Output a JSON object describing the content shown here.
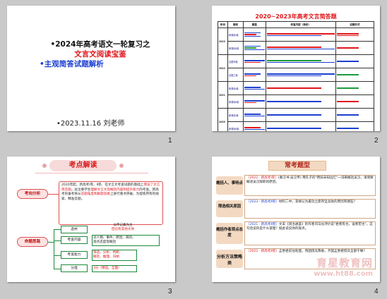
{
  "slides": [
    {
      "number": "1",
      "title_line1": "•2024年高考语文一轮复习之",
      "title_line2": "文言文阅读宝鉴",
      "title_line3": "•主观简答试题解析",
      "date_author": "•2023.11.16  刘老师"
    },
    {
      "number": "2",
      "title": "2020~2023年高考文言简答题",
      "table_headers": [
        "年份",
        "卷别",
        "题型",
        "考查内容（简析）",
        "设题形式"
      ],
      "years": [
        "2023",
        "2022",
        "2021",
        "2020"
      ],
      "papers": [
        "新课标Ⅰ卷",
        "新课标Ⅱ卷",
        "全国甲卷",
        "全国乙卷"
      ]
    },
    {
      "number": "3",
      "title": "考点解读",
      "label_analysis": "考向分析",
      "analysis_text_a": "2020年起，新高考Ⅰ卷、Ⅱ卷、在文言文考查试题的基础上",
      "analysis_text_hl1": "增设了文言简答题",
      "analysis_text_b": "。此注重学生",
      "analysis_text_hl2": "理解文言文及概括内容和提升能力",
      "analysis_text_c": "的考查。新高考的备考将从",
      "analysis_text_hl3": "答题角度和解题思路",
      "analysis_text_d": "上进行重点突破，为提炼所有的线索、精准答题。",
      "label_design": "命题思路",
      "design_items": [
        {
          "label": "选材",
          "desc": "以传记类为主",
          "desc2": "但也有其他文体"
        },
        {
          "label": "考查内容",
          "desc": "对人物、事件、原因、目的、",
          "desc2": "观点态度等概括"
        },
        {
          "label": "考查能力",
          "desc": "筛选、分析、判断、",
          "desc2": "概括、推理、归纳"
        },
        {
          "label": "分值",
          "desc": "3分（精选、全面）",
          "desc2": ""
        }
      ]
    },
    {
      "number": "4",
      "title": "常考题型",
      "items": [
        {
          "label": "概括人、事特点",
          "text_red": "〔2022 · 新高考Ⅰ卷〕",
          "text": "(秦汉书·吴汉传) 用孔子的\"明辩未知远忆\"一词来概括吴汉，请简要概述吴汉辞职的原因。"
        },
        {
          "label": "筛选相关原因",
          "text_red": "〔2023 · 新高考Ⅱ卷〕",
          "text": "材料二中，李靖认为邀功之废存坚兵败的原因有哪些？"
        },
        {
          "label": "概括作者观点态度",
          "text_red": "〔2021 · 新高考Ⅱ卷〕",
          "text": "文末《资治通鉴》的作者司马光评价说\"君者有也，设者宏也\"，这句话说的是什么道理？据此说说你的观点。"
        },
        {
          "label": "分析方法策略类",
          "text_red": "〔2022 · 新高考Ⅱ卷〕",
          "text": "孟尝君前往赵国，燕国借兵救助，齐国孟尝君借兵全部干嘛？"
        }
      ],
      "watermark_cn": "育星教育网",
      "watermark_url": "www.ht88.com"
    }
  ]
}
